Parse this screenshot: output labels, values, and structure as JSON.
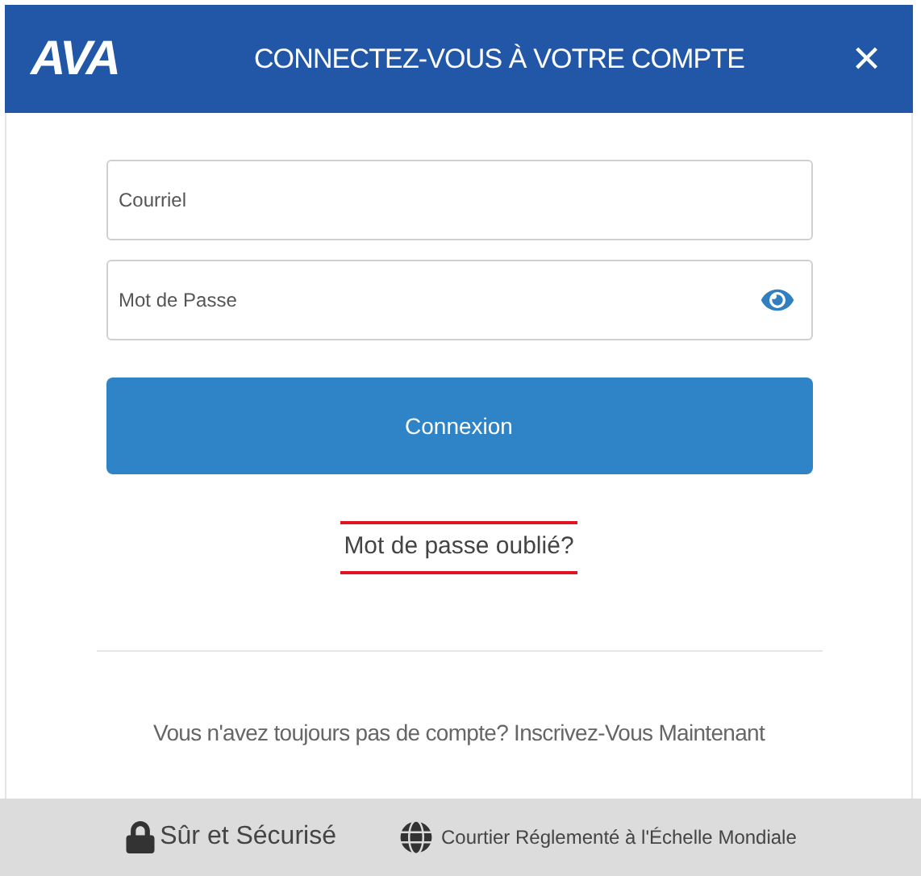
{
  "header": {
    "logo": "AVA",
    "title": "CONNECTEZ-VOUS À VOTRE COMPTE",
    "close": "×"
  },
  "fields": [
    {
      "placeholder": "Courriel",
      "kind": "text"
    },
    {
      "placeholder": "Mot de Passe",
      "kind": "password"
    }
  ],
  "login_button": "Connexion",
  "forgot_link": "Mot de passe oublié?",
  "signup_text": "Vous n'avez toujours pas de compte? Inscrivez-Vous Maintenant",
  "footer": [
    {
      "text": "Sûr et Sécurisé",
      "kind": "lock"
    },
    {
      "text": "Courtier Réglementé à l'Échelle Mondiale",
      "kind": "globe"
    }
  ]
}
